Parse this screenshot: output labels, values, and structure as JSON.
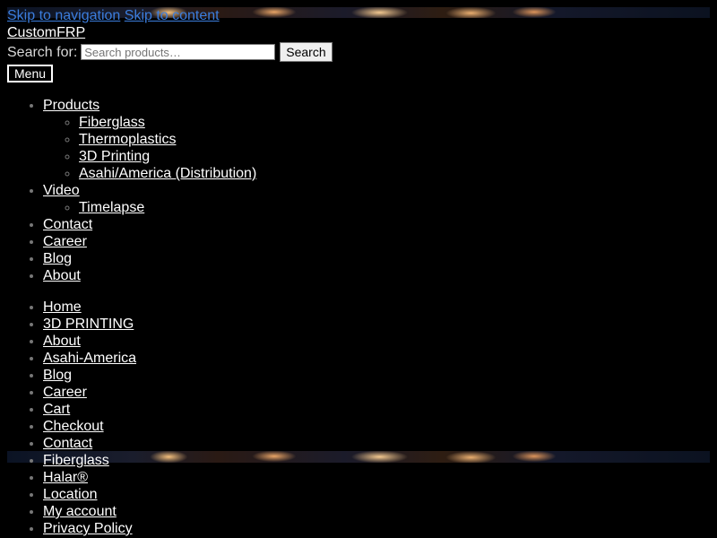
{
  "skip_links": {
    "navigation": "Skip to navigation",
    "content": "Skip to content"
  },
  "site_title": "CustomFRP",
  "search": {
    "label": "Search for:",
    "placeholder": "Search products…",
    "button": "Search"
  },
  "menu_button": "Menu",
  "primary_nav": {
    "products": {
      "label": "Products",
      "children": [
        "Fiberglass",
        "Thermoplastics",
        "3D Printing",
        "Asahi/America (Distribution)"
      ]
    },
    "video": {
      "label": "Video",
      "children": [
        "Timelapse"
      ]
    },
    "contact": "Contact",
    "career": "Career",
    "blog": "Blog",
    "about": "About"
  },
  "pages_nav": [
    "Home",
    "3D PRINTING",
    "About",
    "Asahi-America",
    "Blog",
    "Career",
    "Cart",
    "Checkout",
    "Contact",
    "Fiberglass",
    "Halar®",
    "Location",
    "My account",
    "Privacy Policy"
  ],
  "colors": {
    "background": "#000000",
    "link": "#ffffff",
    "skip_link": "#3b7ddd"
  }
}
